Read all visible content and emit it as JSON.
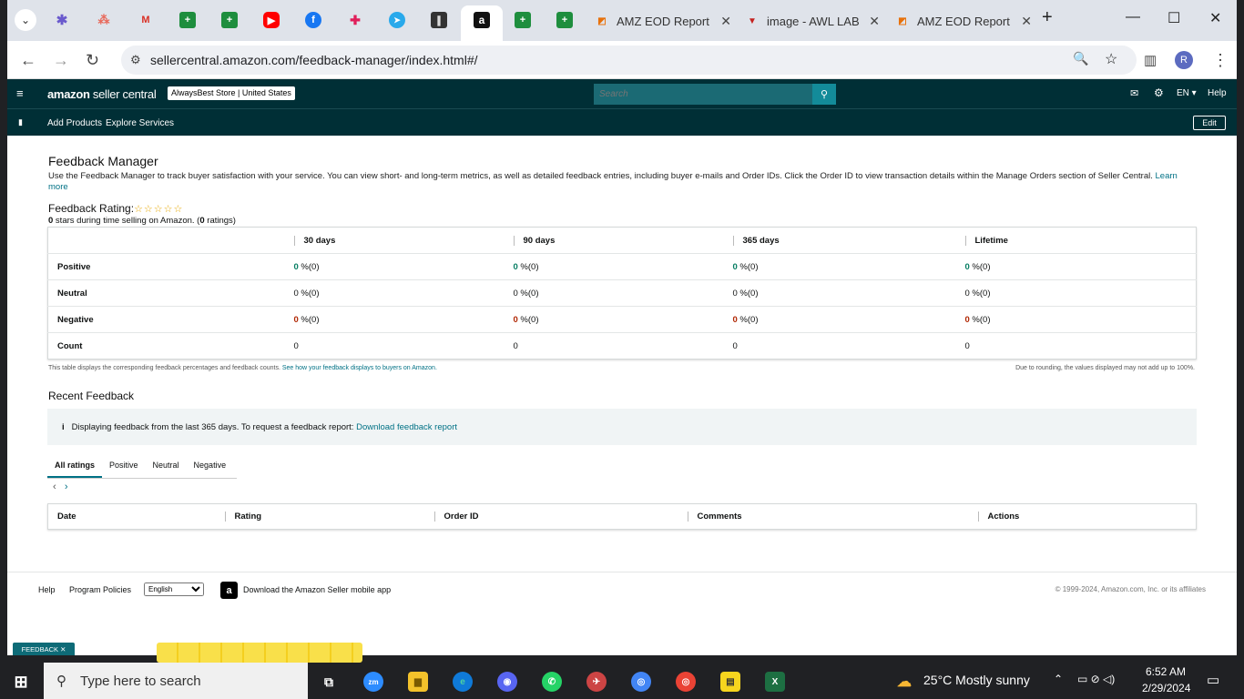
{
  "browser": {
    "tabs": [
      {
        "label": "AMZ EOD Report"
      },
      {
        "label": "image - AWL LAB"
      },
      {
        "label": "AMZ EOD Report"
      }
    ],
    "url": "sellercentral.amazon.com/feedback-manager/index.html#/"
  },
  "header": {
    "logo": "amazon",
    "logo_sub": " seller central",
    "store": "AlwaysBest Store | United States",
    "search_placeholder": "Search",
    "lang": "EN ▾",
    "help": "Help",
    "nav": [
      "Add Products",
      "Explore Services"
    ],
    "edit": "Edit"
  },
  "page": {
    "title": "Feedback Manager",
    "desc": "Use the Feedback Manager to track buyer satisfaction with your service. You can view short- and long-term metrics, as well as detailed feedback entries, including buyer e-mails and Order IDs. Click the Order ID to view transaction details within the Manage Orders section of Seller Central.",
    "learn_more": "Learn more",
    "rating_label": "Feedback Rating:",
    "stars": "☆☆☆☆☆",
    "rating_stars_val": "0",
    "rating_text": " stars during time selling on Amazon. (",
    "rating_count": "0",
    "rating_text2": " ratings)",
    "table": {
      "headers": [
        "30 days",
        "90 days",
        "365 days",
        "Lifetime"
      ],
      "rows": [
        {
          "label": "Positive",
          "cells": [
            "0",
            "0",
            "0",
            "0"
          ],
          "suffix": " %(0)"
        },
        {
          "label": "Neutral",
          "cells": [
            "0",
            "0",
            "0",
            "0"
          ],
          "suffix": " %(0)"
        },
        {
          "label": "Negative",
          "cells": [
            "0",
            "0",
            "0",
            "0"
          ],
          "suffix": " %(0)"
        },
        {
          "label": "Count",
          "cells": [
            "0",
            "0",
            "0",
            "0"
          ]
        }
      ]
    },
    "note_left": "This table displays the corresponding feedback percentages and feedback counts.",
    "note_link": "See how your feedback displays to buyers on Amazon.",
    "note_right": "Due to rounding, the values displayed may not add up to 100%.",
    "recent_title": "Recent Feedback",
    "info_text": "Displaying feedback from the last 365 days. To request a feedback report:",
    "info_link": "Download feedback report",
    "rtabs": [
      "All ratings",
      "Positive",
      "Neutral",
      "Negative"
    ],
    "cols": [
      "Date",
      "Rating",
      "Order ID",
      "Comments",
      "Actions"
    ]
  },
  "footer": {
    "help": "Help",
    "policies": "Program Policies",
    "lang_value": "English",
    "app": "Download the Amazon Seller mobile app",
    "copyright": "© 1999-2024, Amazon.com, Inc. or its affiliates"
  },
  "overlay": {
    "feedback_badge": "FEEDBACK ✕"
  },
  "taskbar": {
    "search": "Type here to search",
    "weather": "25°C  Mostly sunny",
    "time": "6:52 AM",
    "date": "2/29/2024"
  }
}
